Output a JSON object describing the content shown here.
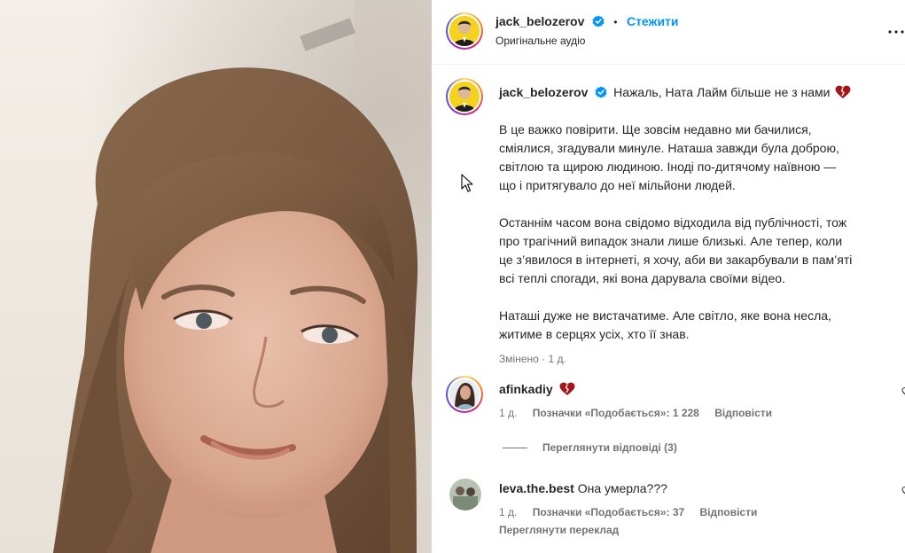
{
  "post": {
    "author": "jack_belozerov",
    "follow_label": "Стежити",
    "dot": "•",
    "audio": "Оригінальне аудіо"
  },
  "caption": {
    "author": "jack_belozerov",
    "headline": "Нажаль, Ната Лайм більше не з нами",
    "para1": [
      "В це важко повірити. Ще зовсім недавно ми бачилися,",
      "сміялися, згадували минуле. Наташа завжди була доброю,",
      "світлою та щирою людиною. Іноді по-дитячому наївною —",
      "що і притягувало до неї мільйони людей."
    ],
    "para2": [
      "Останнім часом вона свідомо відходила від публічності, тож",
      "про трагічний випадок знали лише близькі. Але тепер, коли",
      "це з’явилося в інтернеті, я хочу, аби ви закарбували в пам’яті",
      "всі теплі спогади, які вона дарувала своїми відео."
    ],
    "para3": [
      "Наташі дуже не вистачатиме. Але світло, яке вона несла,",
      "житиме в серцях усіх, хто її знав."
    ],
    "edited": "Змінено",
    "edited_time": "1 д."
  },
  "comments": [
    {
      "user": "afinkadiy",
      "text": "",
      "time": "1 д.",
      "likes": "Позначки «Подобається»: 1 228",
      "reply": "Відповісти",
      "view_replies": "Переглянути відповіді (3)"
    },
    {
      "user": "leva.the.best",
      "text": "Она умерла???",
      "time": "1 д.",
      "likes": "Позначки «Подобається»: 37",
      "reply": "Відповісти",
      "translate": "Переглянути переклад"
    }
  ],
  "icons": [
    "verified-badge-icon",
    "broken-heart-icon",
    "more-options-icon",
    "like-heart-icon",
    "mouse-cursor-icon"
  ],
  "colors": {
    "accent": "#0095f6",
    "verified": "#0095f6",
    "heart": "#a4161a",
    "muted": "#737373"
  }
}
